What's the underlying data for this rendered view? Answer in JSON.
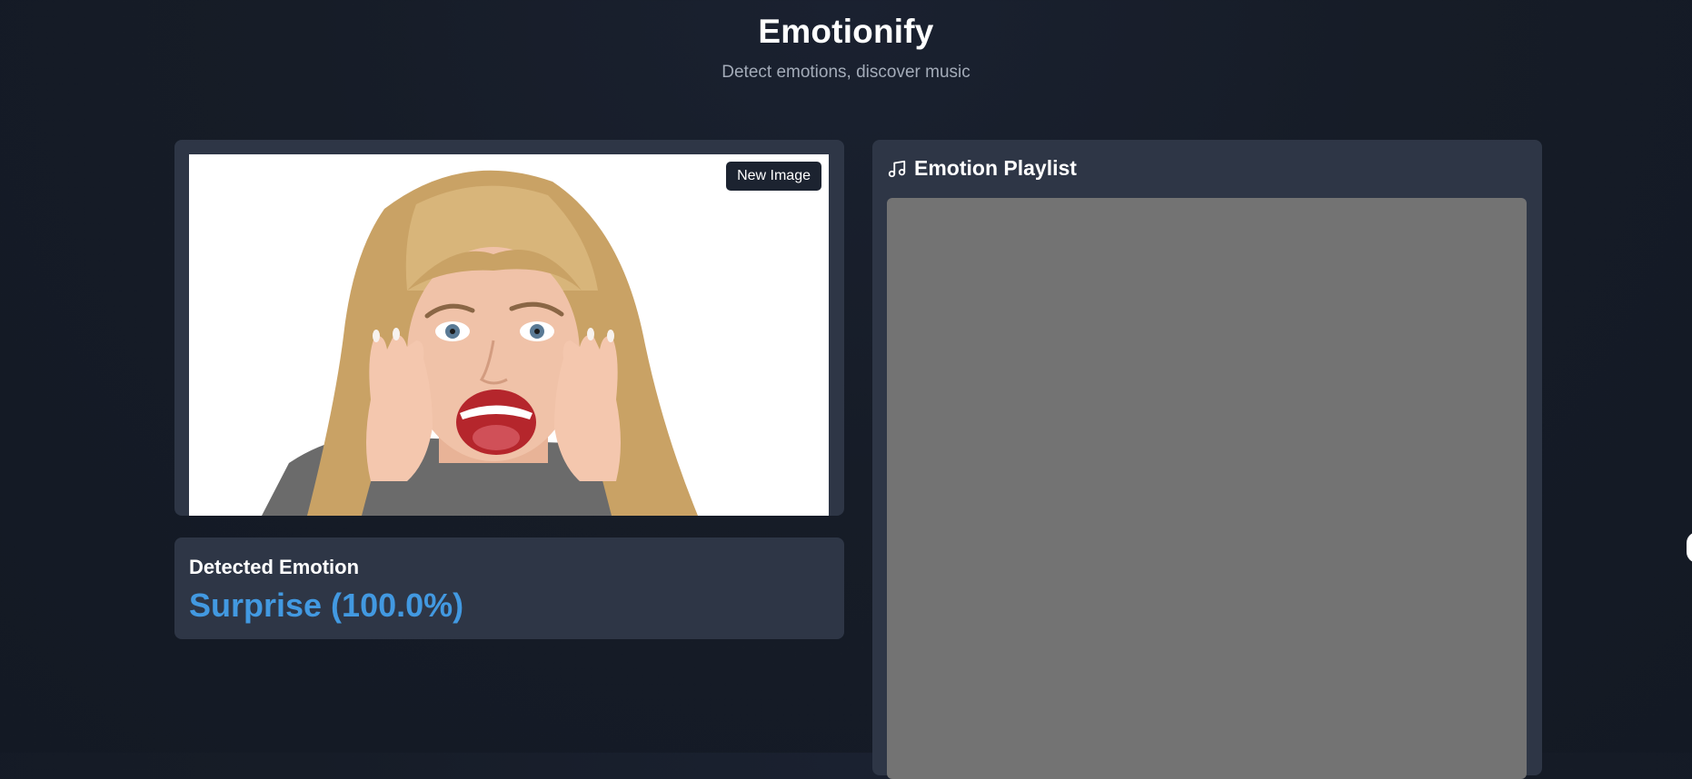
{
  "header": {
    "title": "Emotionify",
    "subtitle": "Detect emotions, discover music"
  },
  "image_panel": {
    "new_image_label": "New Image",
    "photo_subject": "surprised woman with hands on cheeks"
  },
  "emotion": {
    "heading": "Detected Emotion",
    "result": "Surprise (100.0%)",
    "accent_color": "#4299e1"
  },
  "playlist": {
    "icon": "music-note-icon",
    "title": "Emotion Playlist"
  },
  "colors": {
    "background": "#161c27",
    "card": "#2e3646",
    "embed_placeholder": "#737373",
    "subtitle": "#a3abb8"
  }
}
